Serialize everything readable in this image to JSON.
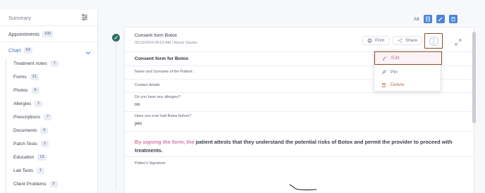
{
  "sidebar": {
    "summary_label": "Summary",
    "appointments": {
      "label": "Appointments",
      "count": "100"
    },
    "chart": {
      "label": "Chart",
      "count": "63"
    },
    "items": [
      {
        "label": "Treatment notes",
        "count": "7"
      },
      {
        "label": "Forms",
        "count": "21"
      },
      {
        "label": "Photos",
        "count": "6"
      },
      {
        "label": "Allergies",
        "count": "1"
      },
      {
        "label": "Prescriptions",
        "count": "7"
      },
      {
        "label": "Documents",
        "count": "9"
      },
      {
        "label": "Patch Tests",
        "count": "2"
      },
      {
        "label": "Education",
        "count": "13"
      },
      {
        "label": "Lab Tests",
        "count": "1"
      },
      {
        "label": "Client Problems",
        "count": "3"
      }
    ]
  },
  "toolbar": {
    "all_label": "All"
  },
  "card": {
    "title": "Consent form Botox",
    "meta": "05/13/2024 09:53 AM | Nicole Davies",
    "print_label": "Print",
    "share_label": "Share"
  },
  "form": {
    "title": "Consent form for Botox",
    "name_label": "Name and Surname of the Patient:",
    "contact_label": "Contact details",
    "allergies_label": "Do you have any allergies?",
    "allergies_value": "no",
    "botox_label": "Have you ever had Botox before?",
    "botox_value": "yes",
    "attest_struck": "By signing the form, the",
    "attest_rest": " patient attests that they understand the potential risks of Botox and permit the provider to proceed with treatments.",
    "signature_label": "Patien's Signature"
  },
  "menu": {
    "edit_label": "Edit",
    "pin_label": "Pin",
    "delete_label": "Delete"
  },
  "colors": {
    "accent": "#4a86d8",
    "highlight_border": "#8b4f2a",
    "delete": "#c8705a"
  }
}
